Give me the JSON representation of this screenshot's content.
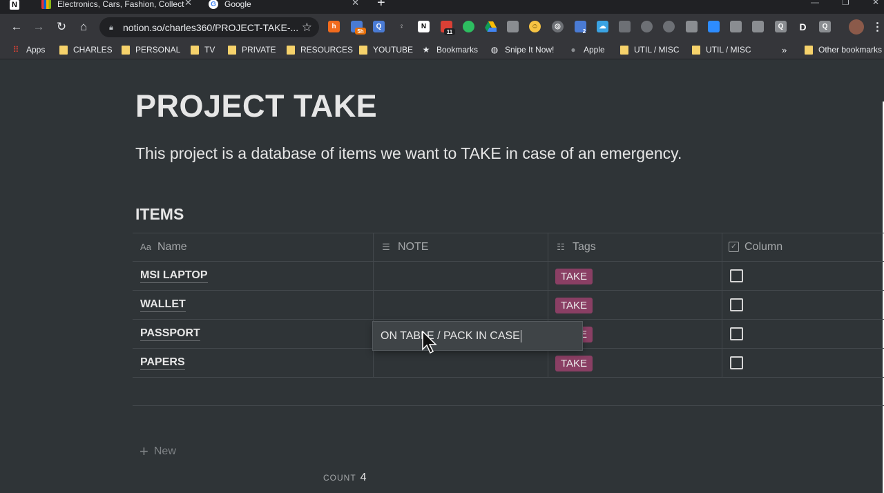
{
  "browser": {
    "tabs": [
      {
        "title": "Electronics, Cars, Fashion, Collect"
      },
      {
        "title": "Google"
      }
    ],
    "new_tab": "+",
    "url": "notion.so/charles360/PROJECT-TAKE-...",
    "bookmarks": [
      {
        "label": "Apps",
        "icon": "apps-grid-icon"
      },
      {
        "label": "CHARLES",
        "icon": "folder-icon"
      },
      {
        "label": "PERSONAL",
        "icon": "folder-icon"
      },
      {
        "label": "TV",
        "icon": "folder-icon"
      },
      {
        "label": "PRIVATE",
        "icon": "folder-icon"
      },
      {
        "label": "RESOURCES",
        "icon": "folder-icon"
      },
      {
        "label": "YOUTUBE",
        "icon": "folder-icon"
      },
      {
        "label": "Bookmarks",
        "icon": "star-icon"
      },
      {
        "label": "Snipe It Now!",
        "icon": "globe-icon"
      },
      {
        "label": "Apple",
        "icon": "apple-icon"
      },
      {
        "label": "UTIL / MISC",
        "icon": "folder-icon"
      },
      {
        "label": "UTIL / MISC",
        "icon": "folder-icon"
      }
    ],
    "bookmarks_overflow": "»",
    "other_bookmarks": "Other bookmarks",
    "extension_badges": {
      "sh": "5h",
      "eleven": "11",
      "two": "2"
    }
  },
  "page": {
    "title": "PROJECT TAKE",
    "description": "This project is a database of items we want to TAKE in case of an emergency.",
    "database_title": "ITEMS",
    "columns": [
      {
        "label": "Name",
        "icon": "Aa"
      },
      {
        "label": "NOTE",
        "icon": "text-lines-icon"
      },
      {
        "label": "Tags",
        "icon": "list-icon"
      },
      {
        "label": "Column",
        "icon": "checkbox-icon"
      }
    ],
    "rows": [
      {
        "name": "MSI LAPTOP",
        "note": "ON TABLE / PACK IN CASE",
        "tag": "TAKE",
        "checked": false
      },
      {
        "name": "WALLET",
        "note": "",
        "tag": "TAKE",
        "checked": false
      },
      {
        "name": "PASSPORT",
        "note": "",
        "tag": "TAKE",
        "checked": false
      },
      {
        "name": "PAPERS",
        "note": "",
        "tag": "TAKE",
        "checked": false
      }
    ],
    "editing_note": "ON TABLE / PACK IN CASE",
    "new_row_label": "New",
    "count_label": "COUNT",
    "count_value": "4"
  },
  "colors": {
    "page_bg": "#2f3437",
    "tag_bg": "#8a3f64",
    "chrome_bg": "#35363a"
  }
}
